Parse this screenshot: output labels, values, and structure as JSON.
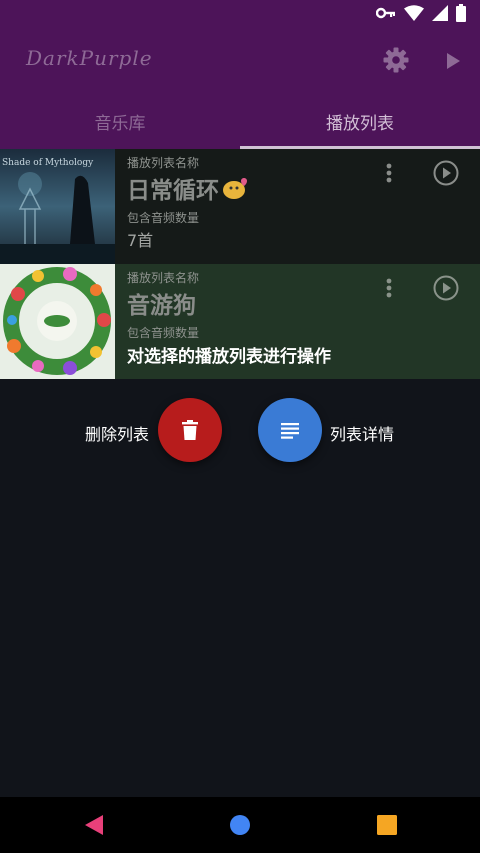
{
  "app": {
    "title": "DarkPurple"
  },
  "tabs": [
    {
      "label": "音乐库",
      "active": false
    },
    {
      "label": "播放列表",
      "active": true
    }
  ],
  "playlists": [
    {
      "name_label": "播放列表名称",
      "name": "日常循环",
      "count_label": "包含音频数量",
      "count": "7首",
      "cover_text": "Shade of Mythology"
    },
    {
      "name_label": "播放列表名称",
      "name": "音游狗",
      "count_label": "包含音频数量",
      "overlay_hint": "对选择的播放列表进行操作"
    }
  ],
  "actions": {
    "delete_label": "删除列表",
    "detail_label": "列表详情"
  },
  "icons": {
    "status": [
      "key-icon",
      "wifi-icon",
      "signal-icon",
      "battery-icon"
    ],
    "header": [
      "gear-icon",
      "play-icon"
    ],
    "row": [
      "more-vert-icon",
      "play-circle-icon"
    ],
    "actions": [
      "trash-icon",
      "list-icon"
    ],
    "nav": [
      "back-triangle-icon",
      "home-circle-icon",
      "recents-square-icon"
    ]
  },
  "colors": {
    "appbar": "#4d1459",
    "background": "#11141a",
    "delete_fab": "#b71c1c",
    "detail_fab": "#3a7bd5",
    "nav_back": "#e8407a",
    "nav_home": "#4285f4",
    "nav_recent": "#f5a623"
  }
}
